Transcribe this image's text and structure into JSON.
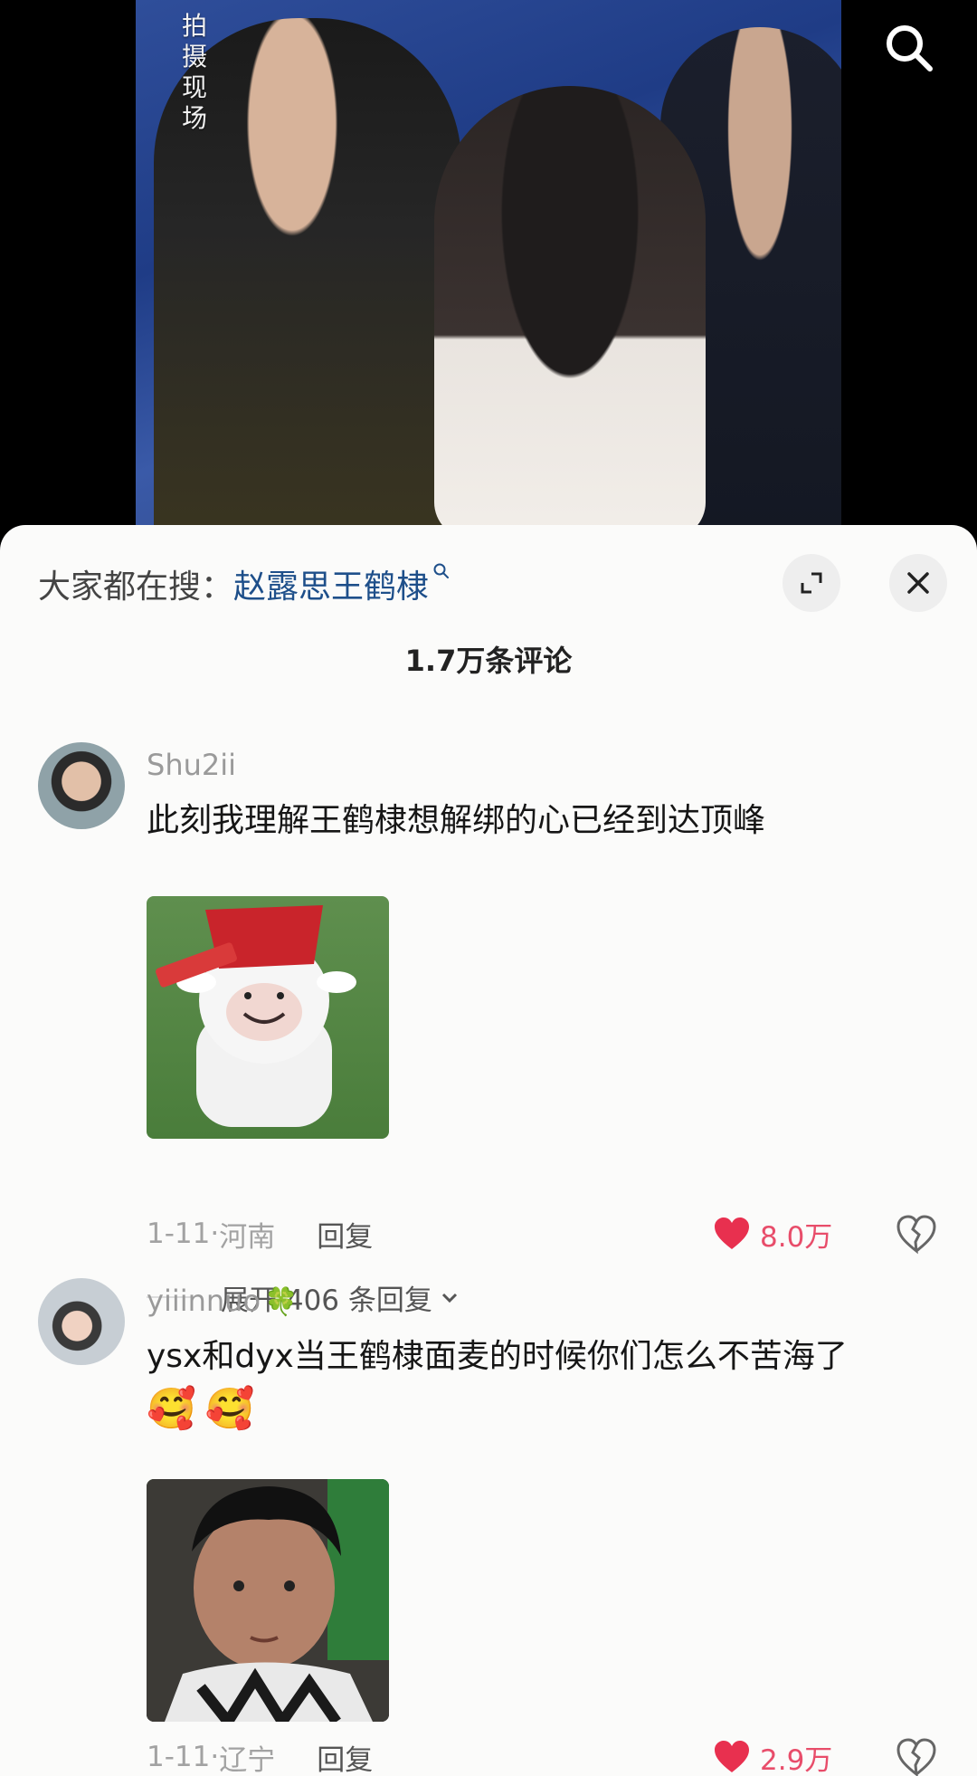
{
  "video": {
    "overlay_text": "拍摄现场"
  },
  "sheet": {
    "trending_label": "大家都在搜：",
    "trending_term": "赵露思王鹤棣",
    "comment_count": "1.7万条评论"
  },
  "comments": [
    {
      "username": "Shu2ii",
      "text": "此刻我理解王鹤棣想解绑的心已经到达顶峰",
      "date": "1-11",
      "location": "河南",
      "reply_label": "回复",
      "likes": "8.0万",
      "expand_label": "展开 406 条回复"
    },
    {
      "username": "yiiinnuo",
      "username_suffix": "🍀",
      "text": "ysx和dyx当王鹤棣面麦的时候你们怎么不苦海了",
      "emojis": [
        "🥰",
        "🥰"
      ],
      "date": "1-11",
      "location": "辽宁",
      "reply_label": "回复",
      "likes": "2.9万"
    }
  ],
  "colors": {
    "accent_link": "#1e4f8a",
    "like_red": "#e84d6a",
    "sheet_bg": "#fbfbfa"
  },
  "icons": [
    "search-icon",
    "expand-icon",
    "close-icon",
    "heart-icon",
    "broken-heart-icon",
    "chevron-down-icon"
  ]
}
